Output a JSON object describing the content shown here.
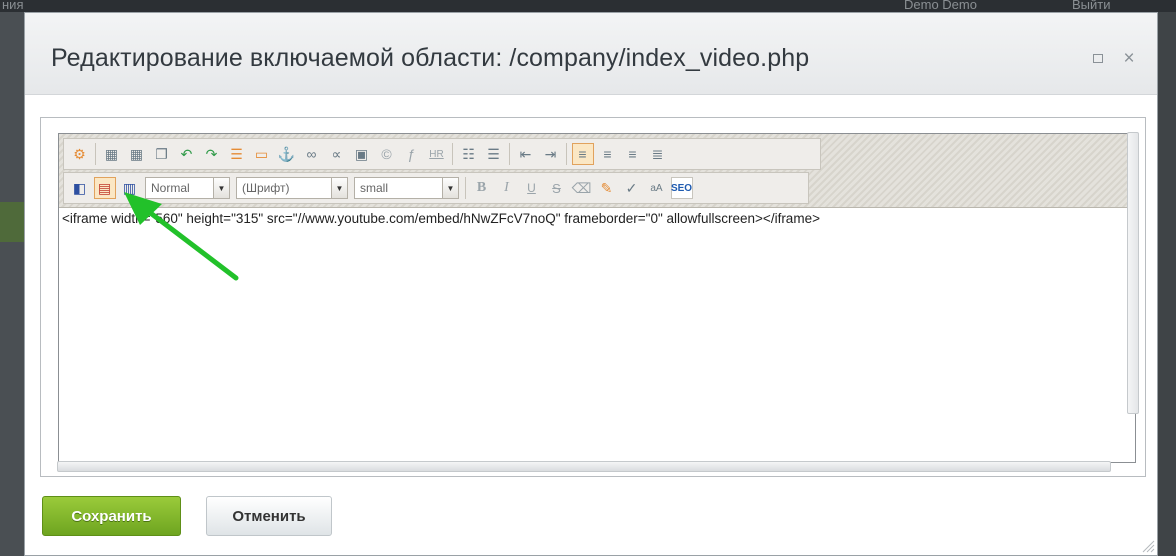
{
  "background": {
    "left_text": "ния",
    "right_user": "Demo Demo",
    "right_logout": "Выйти"
  },
  "dialog": {
    "title": "Редактирование включаемой области: /company/index_video.php",
    "maximize_icon": "maximize-icon",
    "close_glyph": "×"
  },
  "toolbar": {
    "row1_icons": [
      "settings-icon",
      "save-template-icon",
      "save-as-icon",
      "copy-icon",
      "undo-icon",
      "redo-icon",
      "table-icon",
      "split-icon",
      "anchor-icon",
      "link-icon",
      "unlink-icon",
      "image-icon",
      "copyright-icon",
      "flash-icon",
      "hr-icon",
      "numbered-list-icon",
      "bullet-list-icon",
      "outdent-icon",
      "indent-icon",
      "align-left-icon",
      "align-center-icon",
      "align-right-icon",
      "justify-icon"
    ],
    "style_select": {
      "value": "Normal"
    },
    "font_select": {
      "value": "(Шрифт)"
    },
    "size_select": {
      "value": "small"
    },
    "hr_label": "HR",
    "seo_label": "SEO",
    "bold_label": "B",
    "italic_label": "I",
    "underline_label": "U",
    "strike_label": "S"
  },
  "editor": {
    "code": "<iframe width=\"560\" height=\"315\" src=\"//www.youtube.com/embed/hNwZFcV7noQ\" frameborder=\"0\" allowfullscreen></iframe>"
  },
  "buttons": {
    "save": "Сохранить",
    "cancel": "Отменить"
  },
  "colors": {
    "save_green": "#7fb72a",
    "annotation_arrow": "#22c12a"
  }
}
